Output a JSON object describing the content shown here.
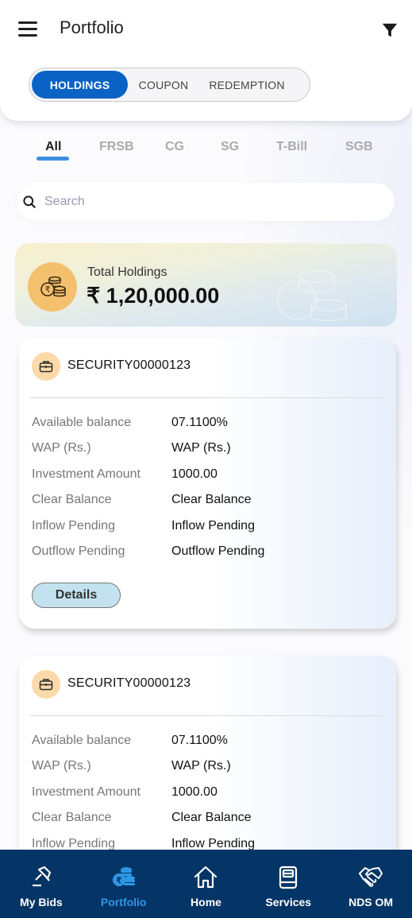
{
  "header": {
    "title": "Portfolio",
    "menu_icon": "hamburger-menu-icon",
    "filter_icon": "filter-funnel-icon"
  },
  "segments": [
    {
      "label": "HOLDINGS",
      "active": true
    },
    {
      "label": "COUPON",
      "active": false
    },
    {
      "label": "REDEMPTION",
      "active": false
    }
  ],
  "categories": [
    {
      "label": "All",
      "active": true
    },
    {
      "label": "FRSB",
      "active": false
    },
    {
      "label": "CG",
      "active": false
    },
    {
      "label": "SG",
      "active": false
    },
    {
      "label": "T-Bill",
      "active": false
    },
    {
      "label": "SGB",
      "active": false
    }
  ],
  "search": {
    "placeholder": "Search",
    "value": ""
  },
  "total_holdings": {
    "label": "Total Holdings",
    "value": "₹ 1,20,000.00",
    "icon": "rupee-coins-icon"
  },
  "securities": [
    {
      "name": "SECURITY00000123",
      "icon": "briefcase-icon",
      "rows": [
        {
          "label": "Available balance",
          "value": "07.1100%"
        },
        {
          "label": "WAP (Rs.)",
          "value": "WAP (Rs.)"
        },
        {
          "label": "Investment Amount",
          "value": "1000.00"
        },
        {
          "label": "Clear Balance",
          "value": "Clear Balance"
        },
        {
          "label": "Inflow Pending",
          "value": "Inflow Pending"
        },
        {
          "label": "Outflow Pending",
          "value": "Outflow Pending"
        }
      ],
      "details_label": "Details"
    },
    {
      "name": "SECURITY00000123",
      "icon": "briefcase-icon",
      "rows": [
        {
          "label": "Available balance",
          "value": "07.1100%"
        },
        {
          "label": "WAP (Rs.)",
          "value": "WAP (Rs.)"
        },
        {
          "label": "Investment Amount",
          "value": "1000.00"
        },
        {
          "label": "Clear Balance",
          "value": "Clear Balance"
        },
        {
          "label": "Inflow Pending",
          "value": "Inflow Pending"
        }
      ]
    }
  ],
  "bottom_nav": [
    {
      "label": "My Bids",
      "icon": "gavel-icon",
      "active": false
    },
    {
      "label": "Portfolio",
      "icon": "rupee-coins-icon",
      "active": true
    },
    {
      "label": "Home",
      "icon": "home-icon",
      "active": false
    },
    {
      "label": "Services",
      "icon": "book-icon",
      "active": false
    },
    {
      "label": "NDS OM",
      "icon": "handshake-icon",
      "active": false
    }
  ],
  "colors": {
    "primary": "#0a63c4",
    "nav_bg": "#053566",
    "nav_active": "#2f98e6",
    "tab_underline": "#3d8ede",
    "coin_circle": "#f5c06e",
    "briefcase_circle": "#fcd9a9",
    "details_button": "#c3e2ef"
  }
}
